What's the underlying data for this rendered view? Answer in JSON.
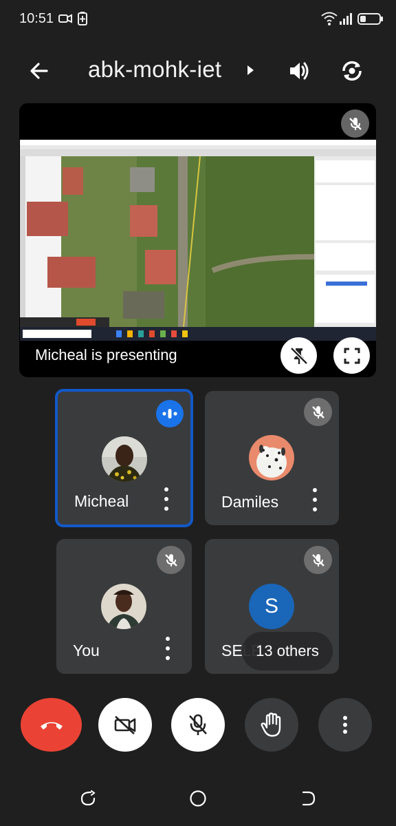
{
  "status_bar": {
    "time": "10:51",
    "icons": [
      "video-camera-icon",
      "battery-saver-icon",
      "wifi-icon",
      "signal-icon",
      "battery-icon"
    ]
  },
  "header": {
    "back_icon": "back-arrow-icon",
    "title": "abk-mohk-iet",
    "caret_icon": "caret-right-icon",
    "speaker_icon": "speaker-icon",
    "switch_camera_icon": "switch-camera-icon"
  },
  "presentation": {
    "label": "Micheal is presenting",
    "mic_muted": true,
    "unpin_icon": "unpin-icon",
    "fullscreen_icon": "fullscreen-icon"
  },
  "participants": [
    {
      "name": "Micheal",
      "speaking": true,
      "muted": false
    },
    {
      "name": "Damiles",
      "speaking": false,
      "muted": true
    },
    {
      "name": "You",
      "speaking": false,
      "muted": true
    },
    {
      "name": "SELE",
      "initial": "S",
      "speaking": false,
      "muted": true
    }
  ],
  "others_label": "13 others",
  "controls": {
    "end_call_icon": "end-call-icon",
    "camera_off_icon": "camera-off-icon",
    "mic_off_icon": "mic-off-icon",
    "raise_hand_icon": "raise-hand-icon",
    "more_icon": "more-vert-icon"
  },
  "colors": {
    "background": "#1f1f1f",
    "tile": "#3a3b3d",
    "active_border": "#1259c8",
    "end_call": "#ea4335",
    "avatar_s": "#1a66b8"
  }
}
